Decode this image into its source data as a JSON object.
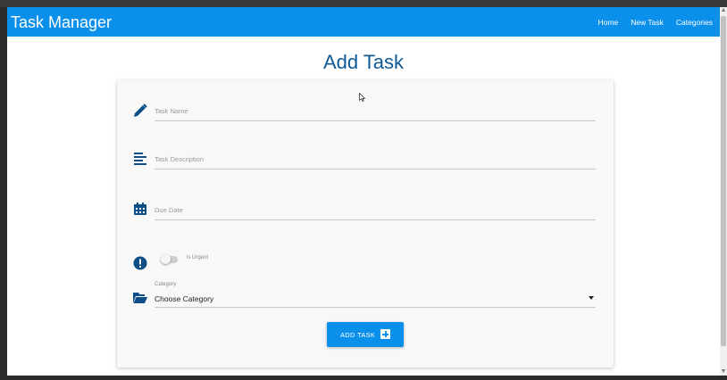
{
  "navbar": {
    "brand": "Task Manager",
    "links": [
      "Home",
      "New Task",
      "Categories"
    ]
  },
  "page": {
    "title": "Add Task"
  },
  "form": {
    "task_name": {
      "placeholder": "Task Name",
      "icon": "pencil-icon"
    },
    "task_description": {
      "placeholder": "Task Description",
      "icon": "align-left-icon"
    },
    "due_date": {
      "placeholder": "Due Date",
      "icon": "calendar-icon"
    },
    "urgent": {
      "label": "is Urgent",
      "icon": "exclamation-circle-icon",
      "checked": false
    },
    "category": {
      "label": "Category",
      "value": "Choose Category",
      "icon": "folder-open-icon"
    },
    "submit": {
      "label": "ADD TASK",
      "icon": "plus-square-icon"
    }
  },
  "colors": {
    "primary": "#0a8fea",
    "title": "#0e5a96",
    "icon": "#0d4f86"
  }
}
